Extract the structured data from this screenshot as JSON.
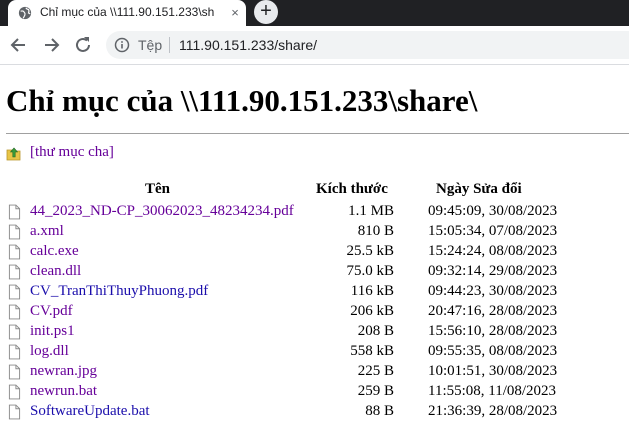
{
  "browser": {
    "tab_title": "Chỉ mục của \\\\111.90.151.233\\share\\",
    "tab_title_visible": "Chỉ mục của \\\\111.90.151.233\\sh",
    "close_glyph": "×",
    "new_tab_glyph": "+",
    "security_label": "Tệp",
    "url": "111.90.151.233/share/"
  },
  "page": {
    "heading": "Chỉ mục của \\\\111.90.151.233\\share\\",
    "parent_link": "[thư mục cha]",
    "columns": {
      "name": "Tên",
      "size": "Kích thước",
      "date": "Ngày Sửa đổi"
    },
    "files": [
      {
        "name": "44_2023_ND-CP_30062023_48234234.pdf",
        "size": "1.1 MB",
        "date": "09:45:09, 30/08/2023",
        "visited": true
      },
      {
        "name": "a.xml",
        "size": "810 B",
        "date": "15:05:34, 07/08/2023",
        "visited": true
      },
      {
        "name": "calc.exe",
        "size": "25.5 kB",
        "date": "15:24:24, 08/08/2023",
        "visited": true
      },
      {
        "name": "clean.dll",
        "size": "75.0 kB",
        "date": "09:32:14, 29/08/2023",
        "visited": true
      },
      {
        "name": "CV_TranThiThuyPhuong.pdf",
        "size": "116 kB",
        "date": "09:44:23, 30/08/2023",
        "visited": false
      },
      {
        "name": "CV.pdf",
        "size": "206 kB",
        "date": "20:47:16, 28/08/2023",
        "visited": true
      },
      {
        "name": "init.ps1",
        "size": "208 B",
        "date": "15:56:10, 28/08/2023",
        "visited": true
      },
      {
        "name": "log.dll",
        "size": "558 kB",
        "date": "09:55:35, 08/08/2023",
        "visited": true
      },
      {
        "name": "newran.jpg",
        "size": "225 B",
        "date": "10:01:51, 30/08/2023",
        "visited": true
      },
      {
        "name": "newrun.bat",
        "size": "259 B",
        "date": "11:55:08, 11/08/2023",
        "visited": true
      },
      {
        "name": "SoftwareUpdate.bat",
        "size": "88 B",
        "date": "21:36:39, 28/08/2023",
        "visited": false
      }
    ]
  },
  "colors": {
    "link": "#1a0dab",
    "visited": "#660099",
    "chrome_dark": "#202124"
  },
  "icons": {
    "tab_favicon": "globe-icon",
    "parent": "folder-up-icon",
    "file": "file-icon",
    "back": "arrow-left-icon",
    "forward": "arrow-right-icon",
    "reload": "reload-icon",
    "info": "info-icon"
  }
}
